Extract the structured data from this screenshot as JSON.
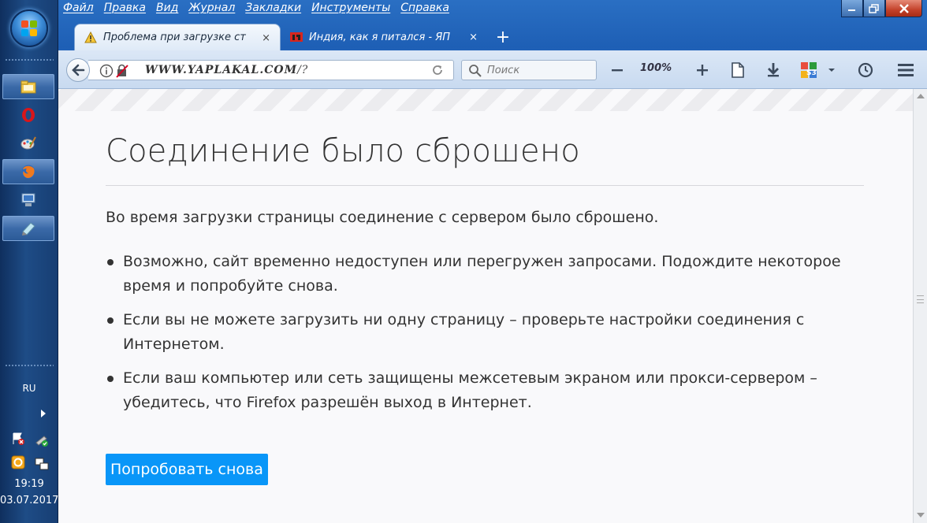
{
  "taskbar": {
    "language": "RU",
    "clock_time": "19:19",
    "clock_date": "03.07.2017",
    "pinned": [
      {
        "name": "explorer-icon"
      },
      {
        "name": "opera-icon"
      },
      {
        "name": "paint-icon"
      },
      {
        "name": "firefox-icon"
      },
      {
        "name": "network-icon"
      },
      {
        "name": "notepad-icon"
      }
    ]
  },
  "menubar": {
    "items": [
      "Файл",
      "Правка",
      "Вид",
      "Журнал",
      "Закладки",
      "Инструменты",
      "Справка"
    ]
  },
  "tabs": [
    {
      "title": "Проблема при загрузке ст",
      "icon": "warning-icon",
      "active": true,
      "close": "×"
    },
    {
      "title": "Индия, как я питался - ЯП",
      "icon": "yaplakal-icon",
      "active": false,
      "close": "×"
    }
  ],
  "newtab": {
    "label": "+"
  },
  "navbar": {
    "url_domain": "WWW.YAPLAKAL.COM",
    "url_rest": "/?",
    "search_placeholder": "Поиск",
    "zoom": "100%"
  },
  "error": {
    "title": "Соединение было сброшено",
    "description": "Во время загрузки страницы соединение с сервером было сброшено.",
    "items": [
      "Возможно, сайт временно недоступен или перегружен запросами. Подождите некоторое время и попробуйте снова.",
      "Если вы не можете загрузить ни одну страницу – проверьте настройки соединения с Интернетом.",
      "Если ваш компьютер или сеть защищены межсетевым экраном или прокси-сервером – убедитесь, что Firefox разрешён выход в Интернет."
    ],
    "retry_label": "Попробовать снова"
  },
  "colors": {
    "accent": "#0996f8",
    "window_chrome": "#1e5fb5",
    "close_button": "#c3412a"
  }
}
